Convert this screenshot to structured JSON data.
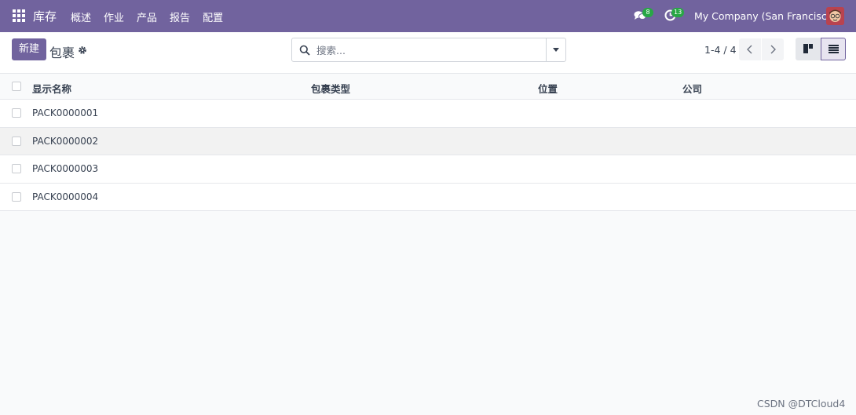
{
  "navbar": {
    "app_name": "库存",
    "menu": [
      "概述",
      "作业",
      "产品",
      "报告",
      "配置"
    ],
    "messages_count": "8",
    "activities_count": "13",
    "company": "My Company (San Francisco)",
    "accent_color": "#71639e"
  },
  "control": {
    "new_label": "新建",
    "title": "包裹",
    "search_placeholder": "搜索...",
    "pager": "1-4 / 4"
  },
  "table": {
    "columns": [
      "显示名称",
      "包裹类型",
      "位置",
      "公司"
    ],
    "rows": [
      {
        "name": "PACK0000001"
      },
      {
        "name": "PACK0000002"
      },
      {
        "name": "PACK0000003"
      },
      {
        "name": "PACK0000004"
      }
    ]
  },
  "watermark": "CSDN @DTCloud4"
}
